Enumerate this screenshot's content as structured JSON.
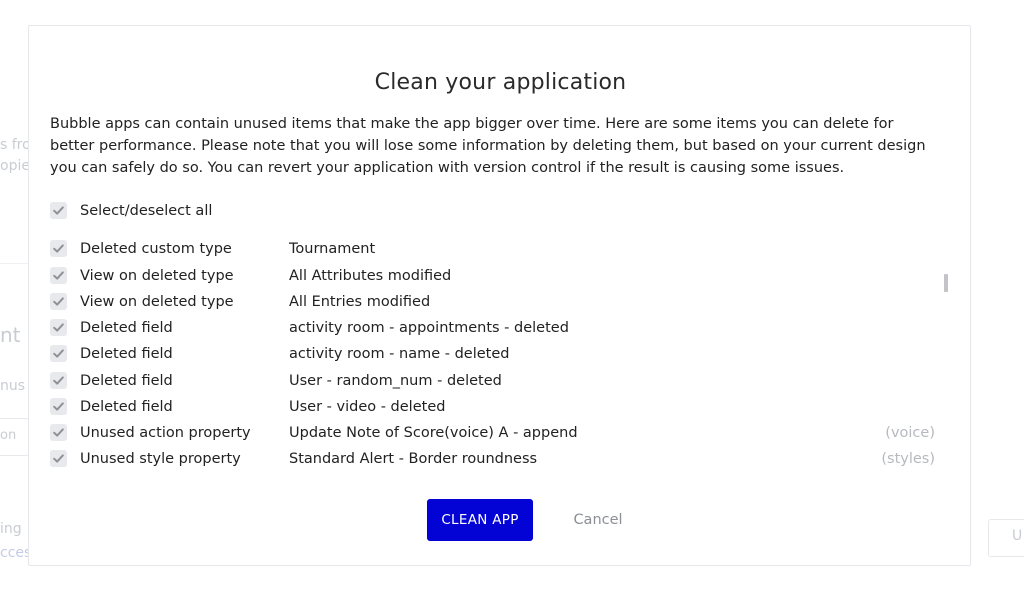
{
  "background": {
    "fragments": [
      {
        "text": "s fro"
      },
      {
        "text": "opie"
      },
      {
        "text": "nt"
      },
      {
        "text": "nus"
      },
      {
        "text": "on"
      },
      {
        "text": "ing"
      },
      {
        "text": "cces"
      },
      {
        "text": "U"
      }
    ]
  },
  "modal": {
    "title": "Clean your application",
    "description": "Bubble apps can contain unused items that make the app bigger over time. Here are some items you can delete for better performance. Please note that you will lose some information by deleting them, but based on your current design you can safely do so. You can revert your application with version control if the result is causing some issues.",
    "select_all_label": "Select/deselect all",
    "items": [
      {
        "type": "Deleted custom type",
        "detail": "Tournament",
        "tag": ""
      },
      {
        "type": "View on deleted type",
        "detail": "All Attributes modified",
        "tag": ""
      },
      {
        "type": "View on deleted type",
        "detail": "All Entries modified",
        "tag": ""
      },
      {
        "type": "Deleted field",
        "detail": "activity room - appointments - deleted",
        "tag": ""
      },
      {
        "type": "Deleted field",
        "detail": "activity room - name - deleted",
        "tag": ""
      },
      {
        "type": "Deleted field",
        "detail": "User - random_num - deleted",
        "tag": ""
      },
      {
        "type": "Deleted field",
        "detail": "User - video - deleted",
        "tag": ""
      },
      {
        "type": "Unused action property",
        "detail": "Update Note of Score(voice) A - append",
        "tag": "(voice)"
      },
      {
        "type": "Unused style property",
        "detail": "Standard Alert - Border roundness",
        "tag": "(styles)"
      }
    ],
    "clean_button_label": "CLEAN APP",
    "cancel_button_label": "Cancel"
  },
  "colors": {
    "primary_button": "#0303d6",
    "checkbox_bg": "#e8e9ec",
    "checkmark": "#8e9196",
    "muted_text": "#b6b9be"
  }
}
